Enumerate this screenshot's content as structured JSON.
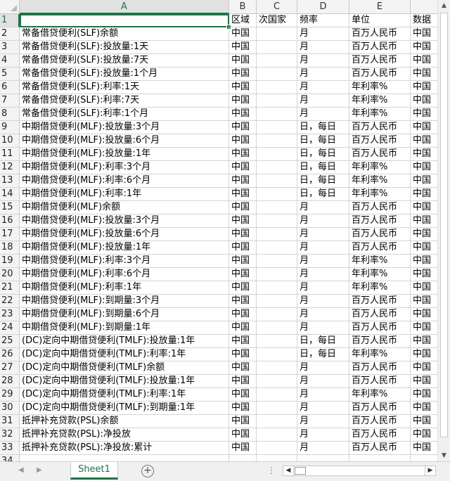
{
  "columns": [
    "A",
    "B",
    "C",
    "D",
    "E"
  ],
  "header_row": [
    "",
    "区域",
    "次国家",
    "频率",
    "单位",
    "数据"
  ],
  "rows": [
    [
      "常备借贷便利(SLF)余额",
      "中国",
      "",
      "月",
      "百万人民币",
      "中国"
    ],
    [
      "常备借贷便利(SLF):投放量:1天",
      "中国",
      "",
      "月",
      "百万人民币",
      "中国"
    ],
    [
      "常备借贷便利(SLF):投放量:7天",
      "中国",
      "",
      "月",
      "百万人民币",
      "中国"
    ],
    [
      "常备借贷便利(SLF):投放量:1个月",
      "中国",
      "",
      "月",
      "百万人民币",
      "中国"
    ],
    [
      "常备借贷便利(SLF):利率:1天",
      "中国",
      "",
      "月",
      "年利率%",
      "中国"
    ],
    [
      "常备借贷便利(SLF):利率:7天",
      "中国",
      "",
      "月",
      "年利率%",
      "中国"
    ],
    [
      "常备借贷便利(SLF):利率:1个月",
      "中国",
      "",
      "月",
      "年利率%",
      "中国"
    ],
    [
      "中期借贷便利(MLF):投放量:3个月",
      "中国",
      "",
      "日，每日",
      "百万人民币",
      "中国"
    ],
    [
      "中期借贷便利(MLF):投放量:6个月",
      "中国",
      "",
      "日，每日",
      "百万人民币",
      "中国"
    ],
    [
      "中期借贷便利(MLF):投放量:1年",
      "中国",
      "",
      "日，每日",
      "百万人民币",
      "中国"
    ],
    [
      "中期借贷便利(MLF):利率:3个月",
      "中国",
      "",
      "日，每日",
      "年利率%",
      "中国"
    ],
    [
      "中期借贷便利(MLF):利率:6个月",
      "中国",
      "",
      "日，每日",
      "年利率%",
      "中国"
    ],
    [
      "中期借贷便利(MLF):利率:1年",
      "中国",
      "",
      "日，每日",
      "年利率%",
      "中国"
    ],
    [
      "中期借贷便利(MLF)余额",
      "中国",
      "",
      "月",
      "百万人民币",
      "中国"
    ],
    [
      "中期借贷便利(MLF):投放量:3个月",
      "中国",
      "",
      "月",
      "百万人民币",
      "中国"
    ],
    [
      "中期借贷便利(MLF):投放量:6个月",
      "中国",
      "",
      "月",
      "百万人民币",
      "中国"
    ],
    [
      "中期借贷便利(MLF):投放量:1年",
      "中国",
      "",
      "月",
      "百万人民币",
      "中国"
    ],
    [
      "中期借贷便利(MLF):利率:3个月",
      "中国",
      "",
      "月",
      "年利率%",
      "中国"
    ],
    [
      "中期借贷便利(MLF):利率:6个月",
      "中国",
      "",
      "月",
      "年利率%",
      "中国"
    ],
    [
      "中期借贷便利(MLF):利率:1年",
      "中国",
      "",
      "月",
      "年利率%",
      "中国"
    ],
    [
      "中期借贷便利(MLF):到期量:3个月",
      "中国",
      "",
      "月",
      "百万人民币",
      "中国"
    ],
    [
      "中期借贷便利(MLF):到期量:6个月",
      "中国",
      "",
      "月",
      "百万人民币",
      "中国"
    ],
    [
      "中期借贷便利(MLF):到期量:1年",
      "中国",
      "",
      "月",
      "百万人民币",
      "中国"
    ],
    [
      "(DC)定向中期借贷便利(TMLF):投放量:1年",
      "中国",
      "",
      "日，每日",
      "百万人民币",
      "中国"
    ],
    [
      "(DC)定向中期借贷便利(TMLF):利率:1年",
      "中国",
      "",
      "日，每日",
      "年利率%",
      "中国"
    ],
    [
      "(DC)定向中期借贷便利(TMLF)余额",
      "中国",
      "",
      "月",
      "百万人民币",
      "中国"
    ],
    [
      "(DC)定向中期借贷便利(TMLF):投放量:1年",
      "中国",
      "",
      "月",
      "百万人民币",
      "中国"
    ],
    [
      "(DC)定向中期借贷便利(TMLF):利率:1年",
      "中国",
      "",
      "月",
      "年利率%",
      "中国"
    ],
    [
      "(DC)定向中期借贷便利(TMLF):到期量:1年",
      "中国",
      "",
      "月",
      "百万人民币",
      "中国"
    ],
    [
      "抵押补充贷款(PSL)余额",
      "中国",
      "",
      "月",
      "百万人民币",
      "中国"
    ],
    [
      "抵押补充贷款(PSL):净投放",
      "中国",
      "",
      "月",
      "百万人民币",
      "中国"
    ],
    [
      "抵押补充贷款(PSL):净投放:累计",
      "中国",
      "",
      "月",
      "百万人民币",
      "中国"
    ],
    [
      "",
      "",
      "",
      "",
      "",
      ""
    ]
  ],
  "row_numbers": [
    "1",
    "2",
    "3",
    "4",
    "5",
    "6",
    "7",
    "8",
    "9",
    "10",
    "11",
    "12",
    "13",
    "14",
    "15",
    "16",
    "17",
    "18",
    "19",
    "20",
    "21",
    "22",
    "23",
    "24",
    "25",
    "26",
    "27",
    "28",
    "29",
    "30",
    "31",
    "32",
    "33",
    "34"
  ],
  "sheet_tab": "Sheet1",
  "accent": "#217346"
}
